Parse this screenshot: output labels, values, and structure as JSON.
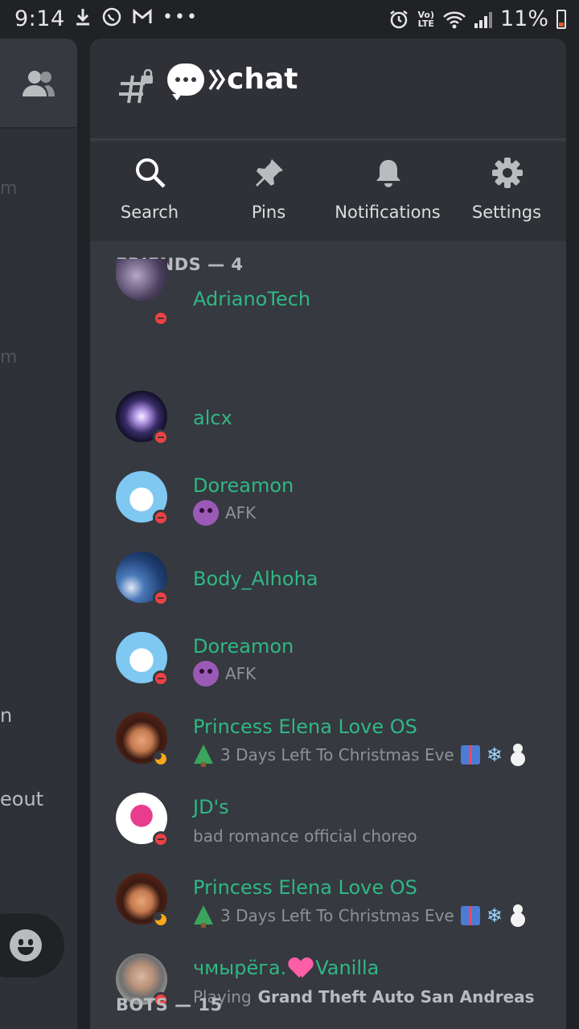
{
  "status_bar": {
    "time": "9:14",
    "battery_percent": "11%",
    "network": "LTE",
    "volte": "Vo)"
  },
  "left_panel": {
    "fragments": [
      "m",
      "m",
      "n",
      "eout"
    ]
  },
  "channel": {
    "name": "chat",
    "icon": "locked-hash-icon"
  },
  "actions": [
    {
      "label": "Search",
      "icon": "search-icon"
    },
    {
      "label": "Pins",
      "icon": "pin-icon"
    },
    {
      "label": "Notifications",
      "icon": "bell-icon"
    },
    {
      "label": "Settings",
      "icon": "gear-icon"
    }
  ],
  "sections": {
    "friends": "FRIENDS — 4",
    "bots": "BOTS — 15"
  },
  "friends": [
    {
      "name": "AdrianoTech",
      "status": "dnd",
      "activity": ""
    },
    {
      "name": "alcx",
      "status": "dnd",
      "activity": ""
    },
    {
      "name": "Doreamon",
      "status": "dnd",
      "activity": "AFK"
    },
    {
      "name": "Body_Alhoha",
      "status": "dnd",
      "activity": ""
    },
    {
      "name": "Doreamon",
      "status": "dnd",
      "activity": "AFK"
    },
    {
      "name": "Princess Elena Love OS",
      "status": "idle",
      "activity": "3 Days Left To Christmas Eve"
    },
    {
      "name": "JD's",
      "status": "dnd",
      "activity": "bad romance official choreo"
    },
    {
      "name": "Princess Elena Love OS",
      "status": "idle",
      "activity": "3 Days Left To Christmas Eve"
    },
    {
      "name_part1": "чмырёга.",
      "name_part2": "Vanilla",
      "status": "dnd",
      "activity_prefix": "Playing",
      "activity_game": "Grand Theft Auto San Andreas"
    }
  ],
  "colors": {
    "member_name": "#2fb883",
    "dnd": "#ed4245",
    "idle": "#faa81a",
    "background": "#36393f"
  }
}
